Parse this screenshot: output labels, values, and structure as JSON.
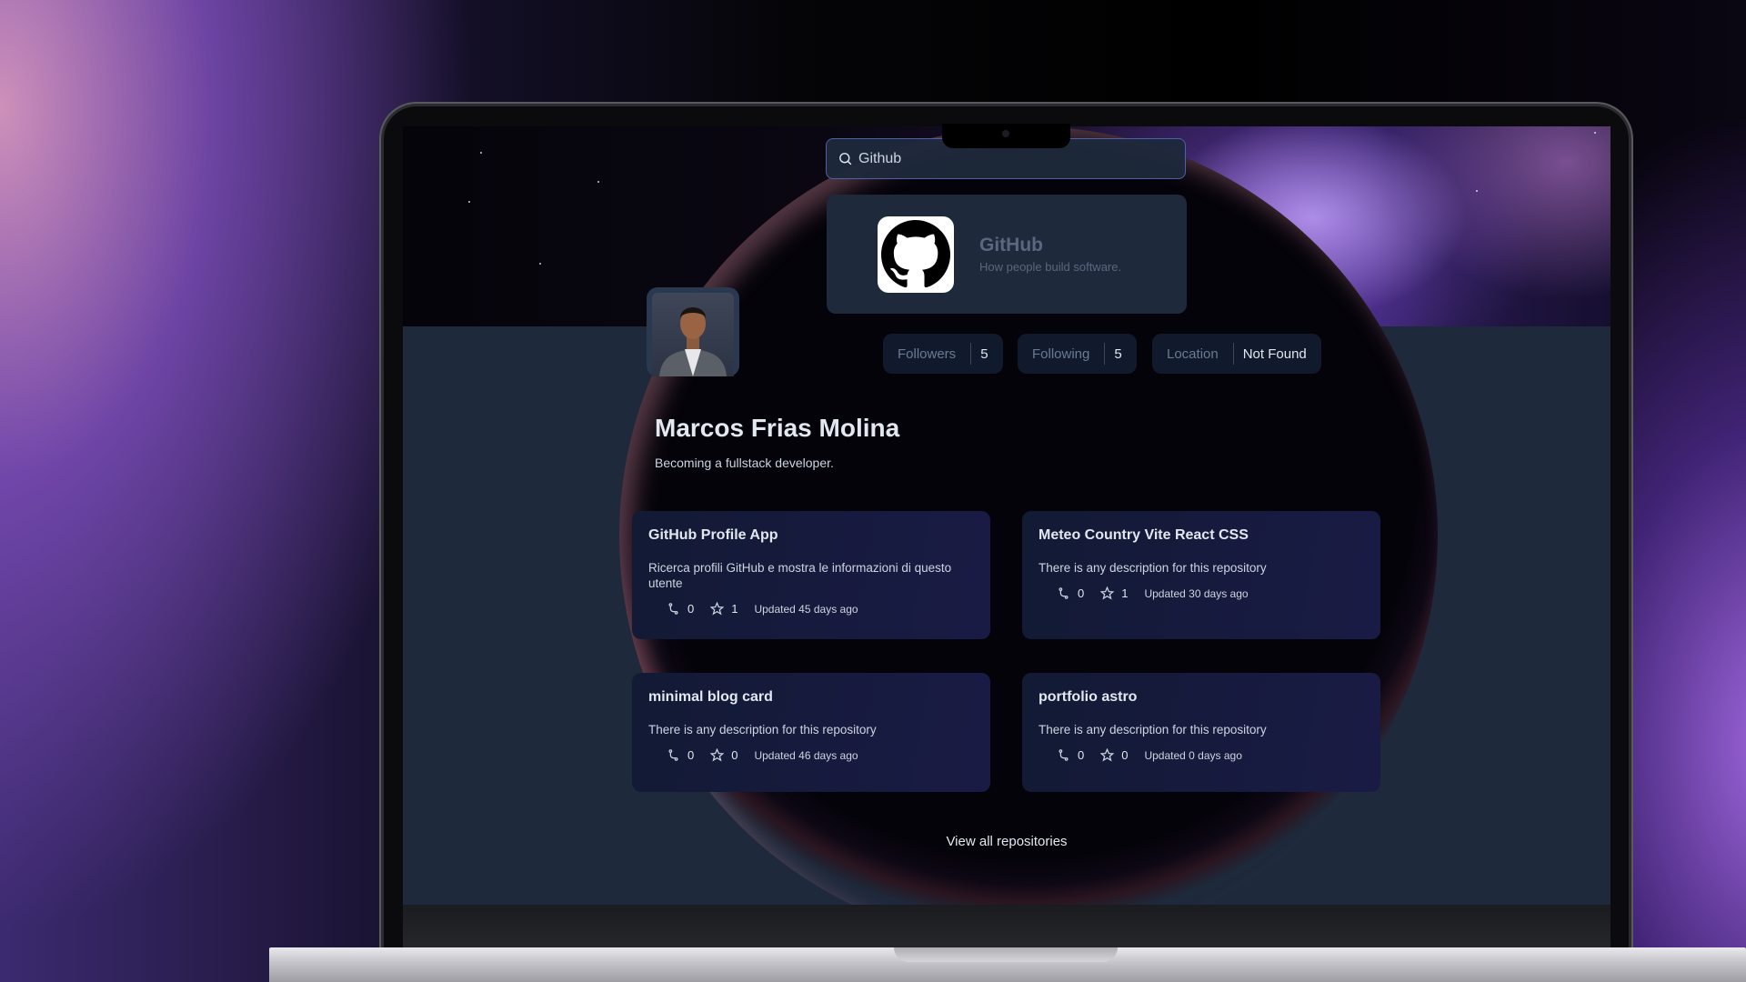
{
  "search": {
    "value": "Github"
  },
  "search_result": {
    "name": "GitHub",
    "tagline": "How people build software."
  },
  "profile": {
    "name": "Marcos Frias Molina",
    "bio": "Becoming a fullstack developer.",
    "stats": [
      {
        "label": "Followers",
        "value": "5"
      },
      {
        "label": "Following",
        "value": "5"
      },
      {
        "label": "Location",
        "value": "Not Found"
      }
    ]
  },
  "repositories": [
    {
      "title": "GitHub Profile App",
      "description": "Ricerca profili GitHub e mostra le informazioni di questo utente",
      "forks": "0",
      "stars": "1",
      "updated": "Updated 45 days ago"
    },
    {
      "title": "Meteo Country Vite React CSS",
      "description": "There is any description for this repository",
      "forks": "0",
      "stars": "1",
      "updated": "Updated 30 days ago"
    },
    {
      "title": "minimal blog card",
      "description": "There is any description for this repository",
      "forks": "0",
      "stars": "0",
      "updated": "Updated 46 days ago"
    },
    {
      "title": "portfolio astro",
      "description": "There is any description for this repository",
      "forks": "0",
      "stars": "0",
      "updated": "Updated 0 days ago"
    }
  ],
  "view_all_label": "View all repositories",
  "icons": {
    "search": "search-icon",
    "fork": "fork-icon",
    "star": "star-icon",
    "logo": "github-logo-icon"
  }
}
